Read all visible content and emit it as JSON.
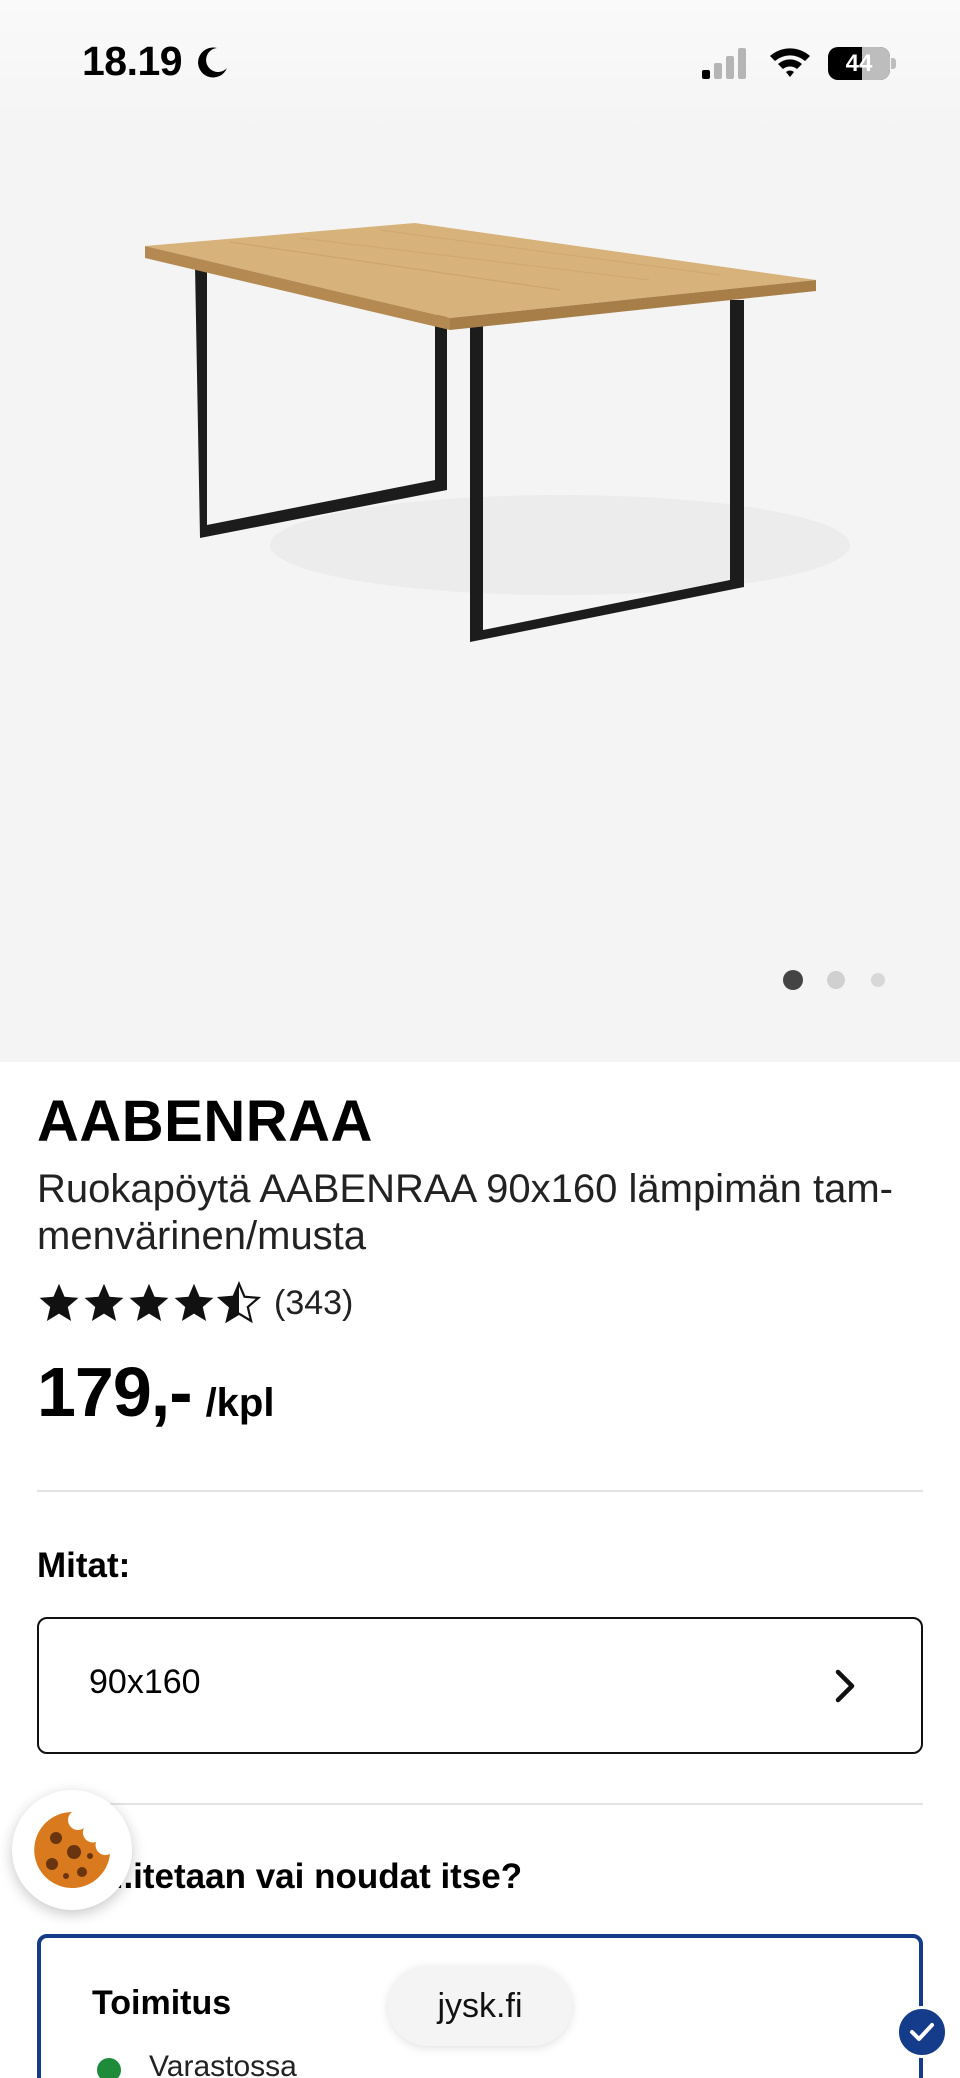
{
  "status_bar": {
    "time": "18.19",
    "battery_level": "44",
    "icons": [
      "moon-icon",
      "signal-icon",
      "wifi-icon",
      "battery-icon"
    ]
  },
  "gallery": {
    "image_label": "AABENRAA dining table",
    "dots_total": 3,
    "active_dot": 1
  },
  "product": {
    "brand": "AABENRAA",
    "name": "Ruokapöytä AABENRAA 90x160 lämpimän tam-menvärinen/musta",
    "rating": 4.5,
    "rating_max": 5,
    "review_count": "(343)",
    "price": "179,-",
    "price_unit": "/kpl"
  },
  "size": {
    "label": "Mitat:",
    "value": "90x160"
  },
  "delivery": {
    "heading": "...itetaan vai noudat itse?",
    "option_title": "Toimitus",
    "stock_text": "Varastossa"
  },
  "browser": {
    "url": "jysk.fi"
  },
  "colors": {
    "accent": "#143c8a",
    "in_stock": "#1e8b3a",
    "cookie": "#d97a1e"
  }
}
